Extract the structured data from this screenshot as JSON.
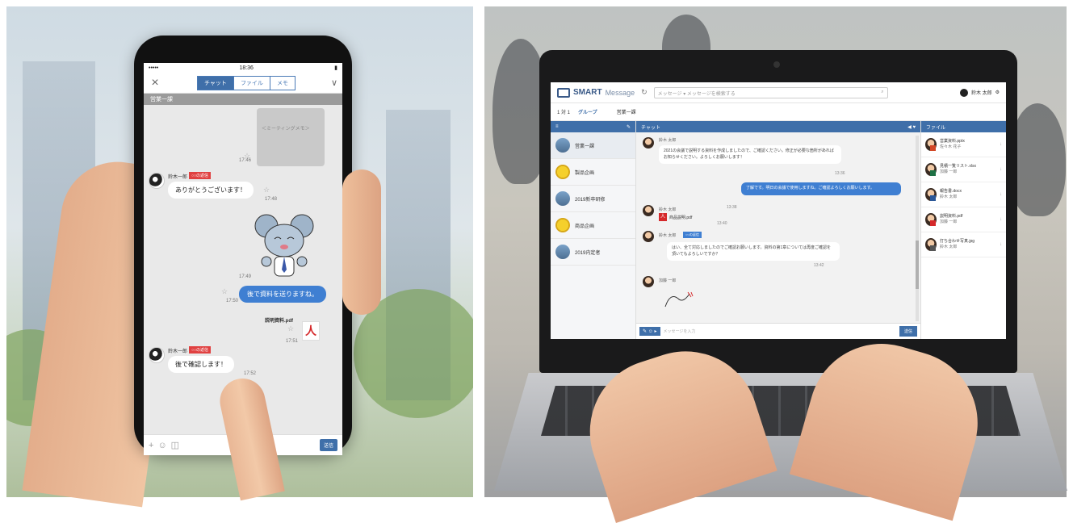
{
  "phone": {
    "status": {
      "carrier": "•••••",
      "time": "18:36",
      "battery": "▮"
    },
    "close_icon": "×",
    "tabs": [
      "チャット",
      "ファイル",
      "メモ"
    ],
    "menu_icon": "∨",
    "room_title": "営業一課",
    "image_card_lines": [
      "　　",
      "＜ミーティングメモ＞",
      "　　",
      "　　"
    ],
    "messages": [
      {
        "time": "17:46"
      },
      {
        "name": "鈴木一郎",
        "tag": "○○の返信",
        "text": "ありがとうございます！",
        "time": "17:48"
      },
      {
        "time": "17:49"
      },
      {
        "text": "後で資料を送りますね。",
        "time": "17:50"
      },
      {
        "file_name": "説明資料.pdf",
        "time": "17:51"
      },
      {
        "name": "鈴木一郎",
        "tag": "○○の返信",
        "text": "後で確認します！",
        "time": "17:52"
      }
    ],
    "input": {
      "plus": "+",
      "emoji": "☺",
      "stamp": "◫",
      "send_label": "送信"
    }
  },
  "laptop": {
    "logo_text": "SMART",
    "logo_sub": "Message",
    "search_scope": "メッセージ",
    "search_placeholder": "メッセージを検索する",
    "user_name": "鈴木 太郎",
    "sub_tabs": [
      "1 対 1",
      "グループ"
    ],
    "room_header": "営業一課",
    "left_bar_label": "≡",
    "rooms": [
      "営業一課",
      "製品企画",
      "2019新卒研修",
      "商品企画",
      "2019内定者"
    ],
    "chat_bar_label": "チャット",
    "messages": [
      {
        "name": "鈴木 太郎",
        "text": "2021の会議で説明する資料を作成しましたので、ご確認ください。修正が必要な箇所があればお知らせください。よろしくお願いします！",
        "time": "13:36"
      },
      {
        "text": "了解です。明日の会議で使用しますね。ご確認よろしくお願いします。",
        "time": "13:38"
      },
      {
        "name": "鈴木 太郎",
        "file": "商品説明.pdf",
        "time": "13:40"
      },
      {
        "name": "鈴木 太郎",
        "tag": "○○の返信",
        "text": "はい、全て対応しましたのでご確認お願いします。資料の第1章については再度ご確認を頂いてもよろしいですか？",
        "time": "13:42"
      },
      {
        "name": "加藤 一郎"
      }
    ],
    "input": {
      "tools": "✎ ☺ ▸",
      "placeholder": "メッセージを入力",
      "send_label": "送信"
    },
    "files_bar_label": "ファイル",
    "files": [
      {
        "name": "営業資料.pptx",
        "user": "佐々木 花子",
        "badge_color": "#d24726"
      },
      {
        "name": "見積一覧リスト.xlsx",
        "user": "加藤 一郎",
        "badge_color": "#1e7145"
      },
      {
        "name": "報告書.docx",
        "user": "鈴木 太郎",
        "badge_color": "#2b5797"
      },
      {
        "name": "説明資料.pdf",
        "user": "加藤 一郎",
        "badge_color": "#d5292b"
      },
      {
        "name": "打ち合わせ写真.jpg",
        "user": "鈴木 太郎",
        "badge_color": "#555555"
      }
    ]
  }
}
